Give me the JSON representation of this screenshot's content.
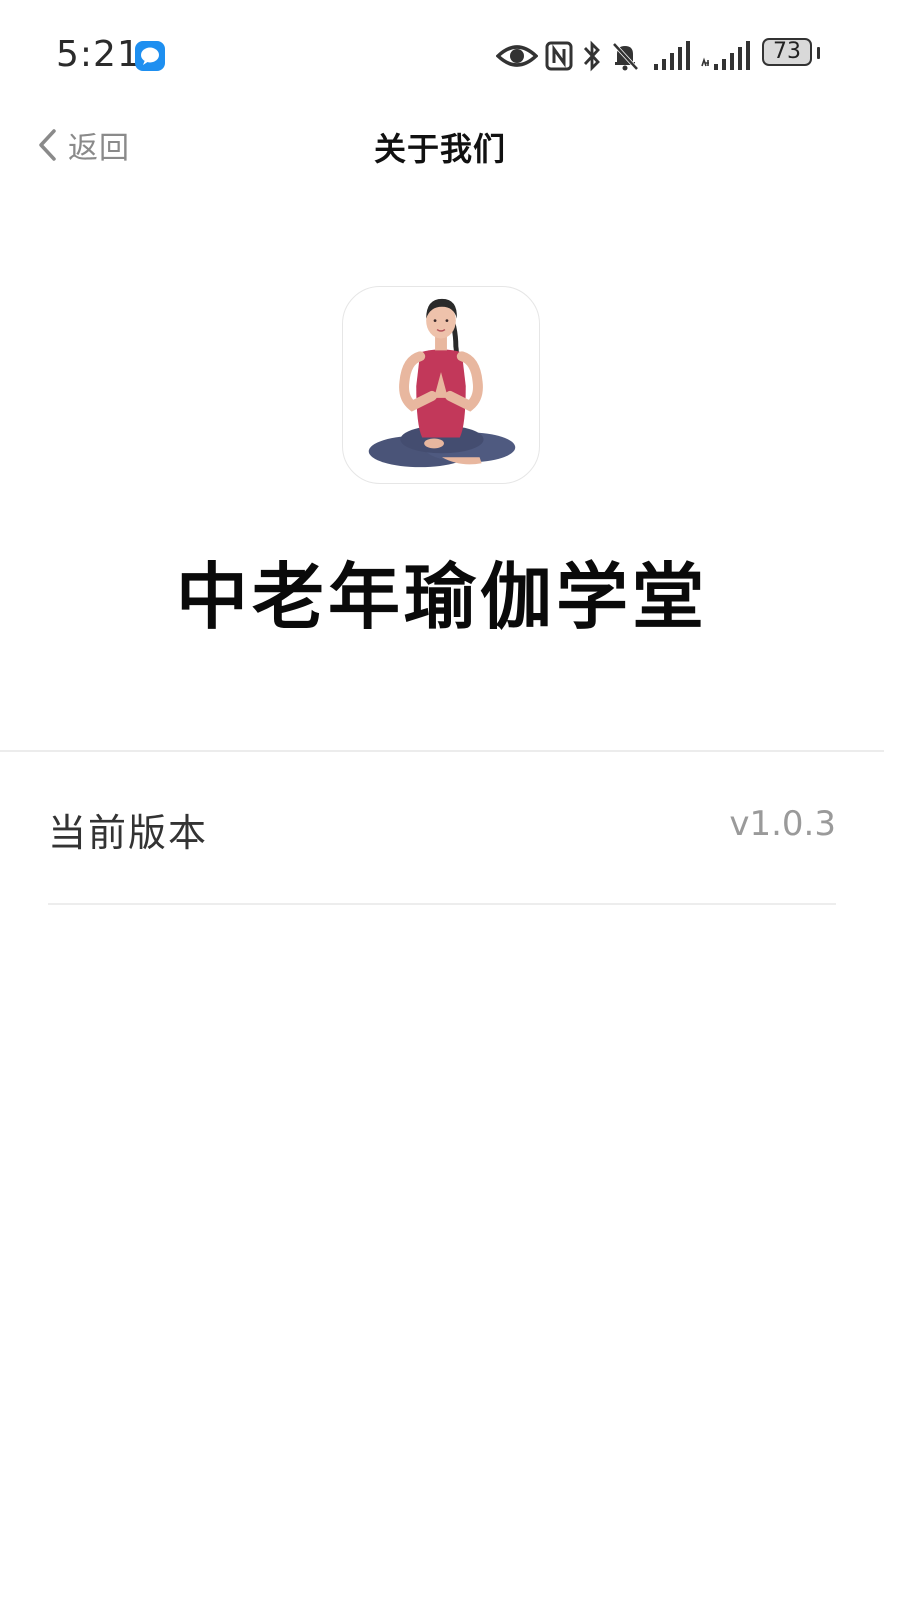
{
  "status_bar": {
    "time": "5:21",
    "battery_level": "73",
    "icons": [
      "message-bubble-icon",
      "eye-icon",
      "nfc-icon",
      "bluetooth-icon",
      "bell-mute-icon",
      "signal-icon",
      "signal-icon"
    ]
  },
  "nav": {
    "back_label": "返回",
    "title": "关于我们"
  },
  "app": {
    "name": "中老年瑜伽学堂",
    "logo": "yoga-meditation-icon"
  },
  "settings": {
    "version_label": "当前版本",
    "version_value": "v1.0.3"
  },
  "colors": {
    "accent_blue": "#1e8ff0",
    "shirt_pink": "#c2385a",
    "pants_navy": "#4a5478",
    "text_gray": "#8a8a8a"
  }
}
